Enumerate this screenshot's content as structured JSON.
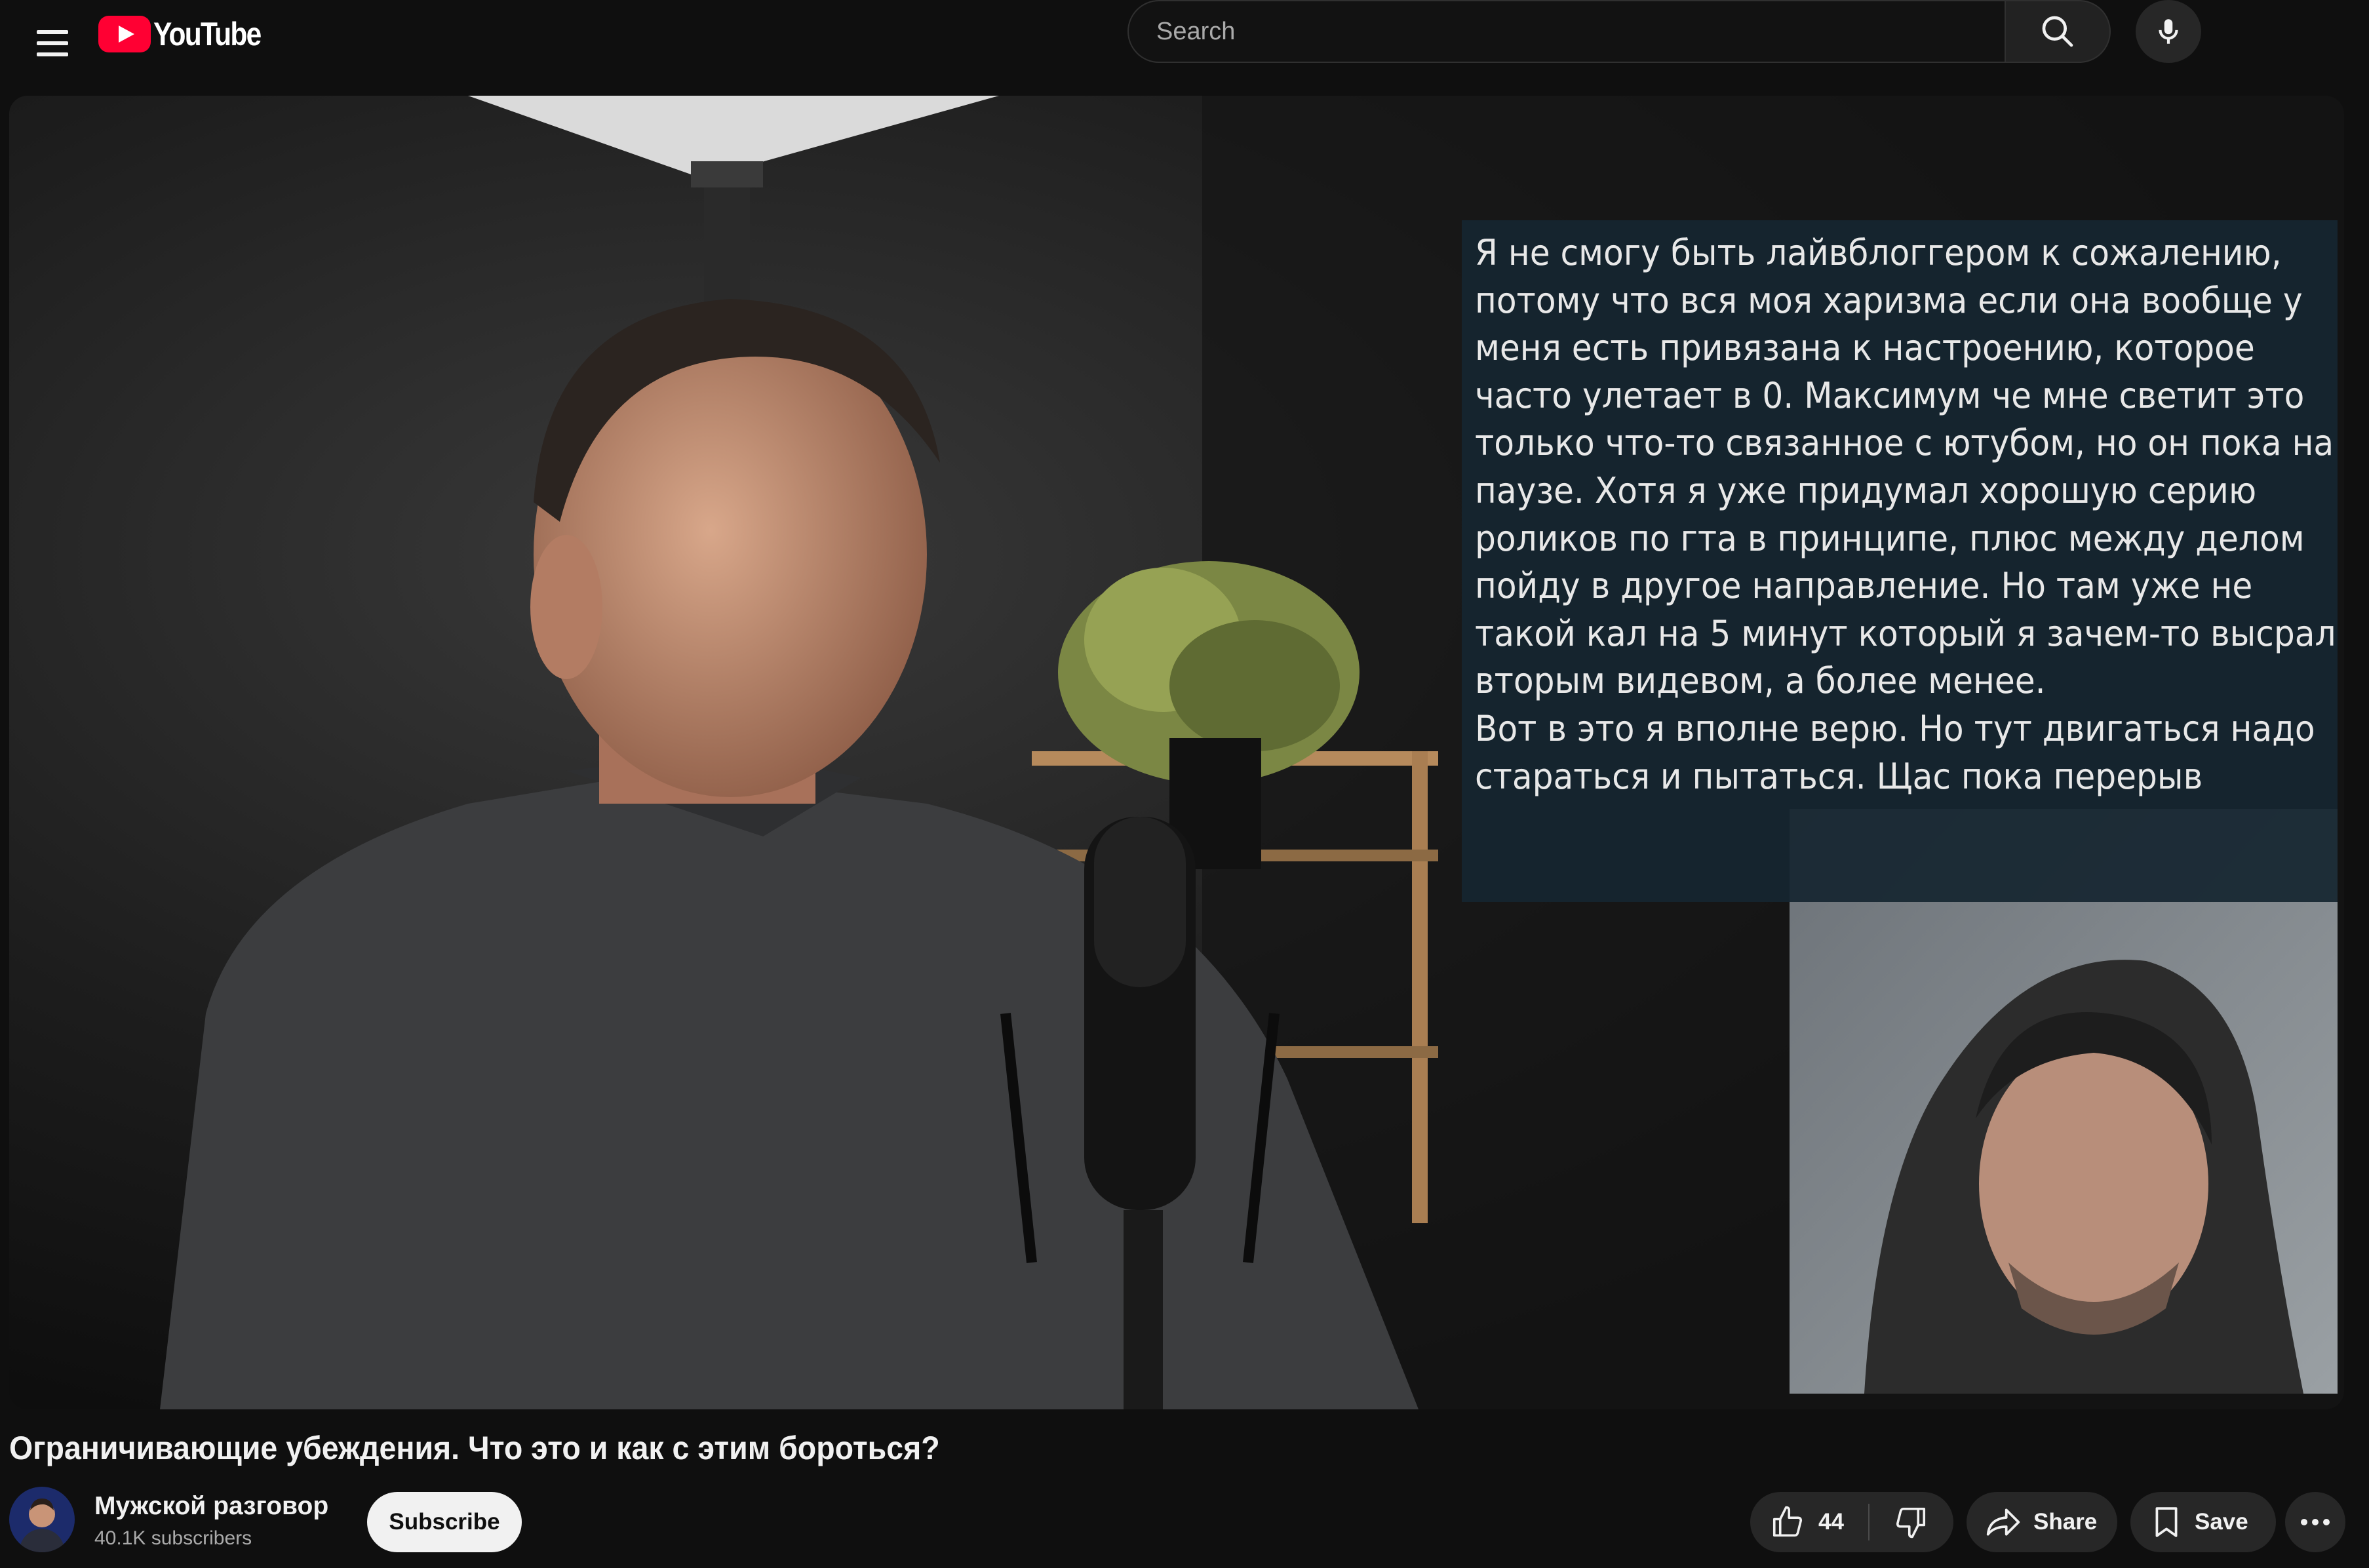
{
  "header": {
    "logo_text": "YouTube",
    "search_placeholder": "Search"
  },
  "video": {
    "caption_lines": [
      "Я не смогу быть лайвблоггером к сожалению,",
      "потому что вся моя харизма если она вообще у",
      "меня есть привязана к настроению, которое",
      "часто улетает в 0. Максимум че мне светит это",
      "только что-то связанное с ютубом, но он пока на",
      "паузе. Хотя я уже придумал хорошую серию",
      "роликов по гта в принципе, плюс между делом",
      "пойду в другое направление. Но там уже не",
      "такой кал на 5 минут который я зачем-то высрал",
      "вторым видевом, а более менее.",
      "Вот в это я вполне верю. Но тут двигаться надо",
      "стараться и пытаться. Щас пока перерыв"
    ],
    "title": "Ограничивающие убеждения. Что это и как с этим бороться?"
  },
  "channel": {
    "name": "Мужской разговор",
    "subscribers": "40.1K subscribers",
    "subscribe_label": "Subscribe"
  },
  "actions": {
    "like_count": "44",
    "share_label": "Share",
    "save_label": "Save"
  },
  "icons": {
    "menu": "hamburger-menu-icon",
    "search": "search-icon",
    "mic": "mic-icon",
    "like": "thumbs-up-icon",
    "dislike": "thumbs-down-icon",
    "share": "share-arrow-icon",
    "save": "bookmark-icon",
    "more": "more-horizontal-icon"
  },
  "colors": {
    "background": "#0f0f0f",
    "brand_red": "#ff0033",
    "pill_bg": "#272727",
    "caption_bg": "#162630"
  }
}
